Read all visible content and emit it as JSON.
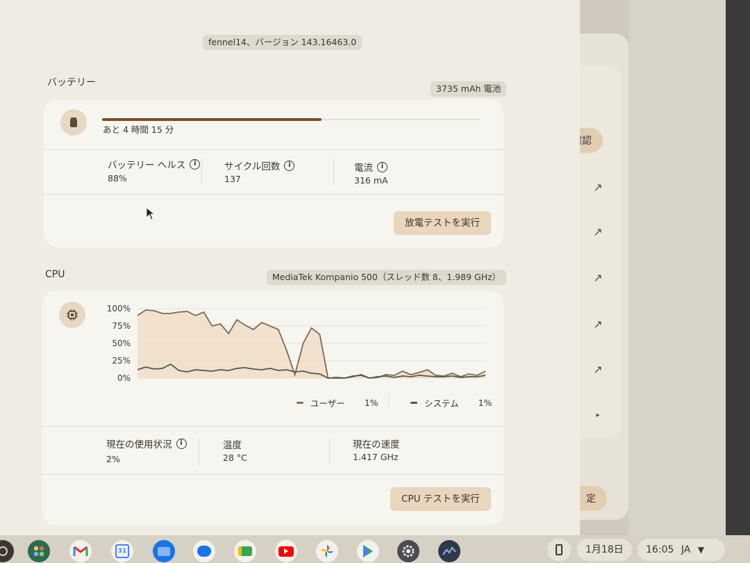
{
  "header": {
    "version": "fennel14、バージョン 143.16463.0"
  },
  "battery": {
    "title": "バッテリー",
    "capacity": "3735 mAh 電池",
    "time_remaining": "あと 4 時間 15 分",
    "charge_fraction": 0.58,
    "stats": [
      {
        "label": "バッテリー ヘルス",
        "value": "88%"
      },
      {
        "label": "サイクル回数",
        "value": "137"
      },
      {
        "label": "電流",
        "value": "316 mA"
      }
    ],
    "button": "放電テストを実行"
  },
  "cpu": {
    "title": "CPU",
    "model": "MediaTek Kompanio 500（スレッド数 8、1.989 GHz）",
    "legend": [
      {
        "name": "ユーザー",
        "value": "1%"
      },
      {
        "name": "システム",
        "value": "1%"
      }
    ],
    "stats": [
      {
        "label": "現在の使用状況",
        "value": "2%"
      },
      {
        "label": "温度",
        "value": "28 °C"
      },
      {
        "label": "現在の速度",
        "value": "1.417 GHz"
      }
    ],
    "button": "CPU テストを実行"
  },
  "chart_data": {
    "type": "area",
    "yticks": [
      "100%",
      "75%",
      "50%",
      "25%",
      "0%"
    ],
    "ylim": [
      0,
      100
    ],
    "colors": {
      "user_line": "#7a6a55",
      "user_fill": "#f0d9c4",
      "system_line": "#4e5a45"
    },
    "series": [
      {
        "name": "ユーザー",
        "values": [
          90,
          98,
          97,
          93,
          93,
          95,
          96,
          90,
          95,
          75,
          78,
          64,
          84,
          76,
          70,
          80,
          75,
          70,
          40,
          5,
          50,
          72,
          63,
          0,
          0,
          0,
          2,
          5,
          0,
          1,
          5,
          4,
          10,
          5,
          8,
          12,
          4,
          3,
          7,
          2,
          6,
          4,
          10
        ]
      },
      {
        "name": "システム",
        "values": [
          12,
          16,
          13,
          14,
          20,
          11,
          9,
          12,
          11,
          10,
          12,
          11,
          14,
          15,
          13,
          12,
          14,
          11,
          12,
          9,
          10,
          7,
          6,
          0,
          1,
          0,
          3,
          4,
          0,
          2,
          3,
          1,
          3,
          2,
          4,
          3,
          2,
          2,
          3,
          1,
          2,
          2,
          4
        ]
      }
    ]
  },
  "side_window": {
    "button_top": "確認",
    "button_bottom": "定"
  },
  "taskbar": {
    "apps": [
      "launcher",
      "gmail",
      "calendar",
      "files",
      "messages",
      "meet",
      "youtube",
      "photos",
      "play",
      "settings",
      "diagnostics"
    ],
    "calendar_day": "31",
    "date": "1月18日",
    "time": "16:05",
    "ime": "JA"
  }
}
